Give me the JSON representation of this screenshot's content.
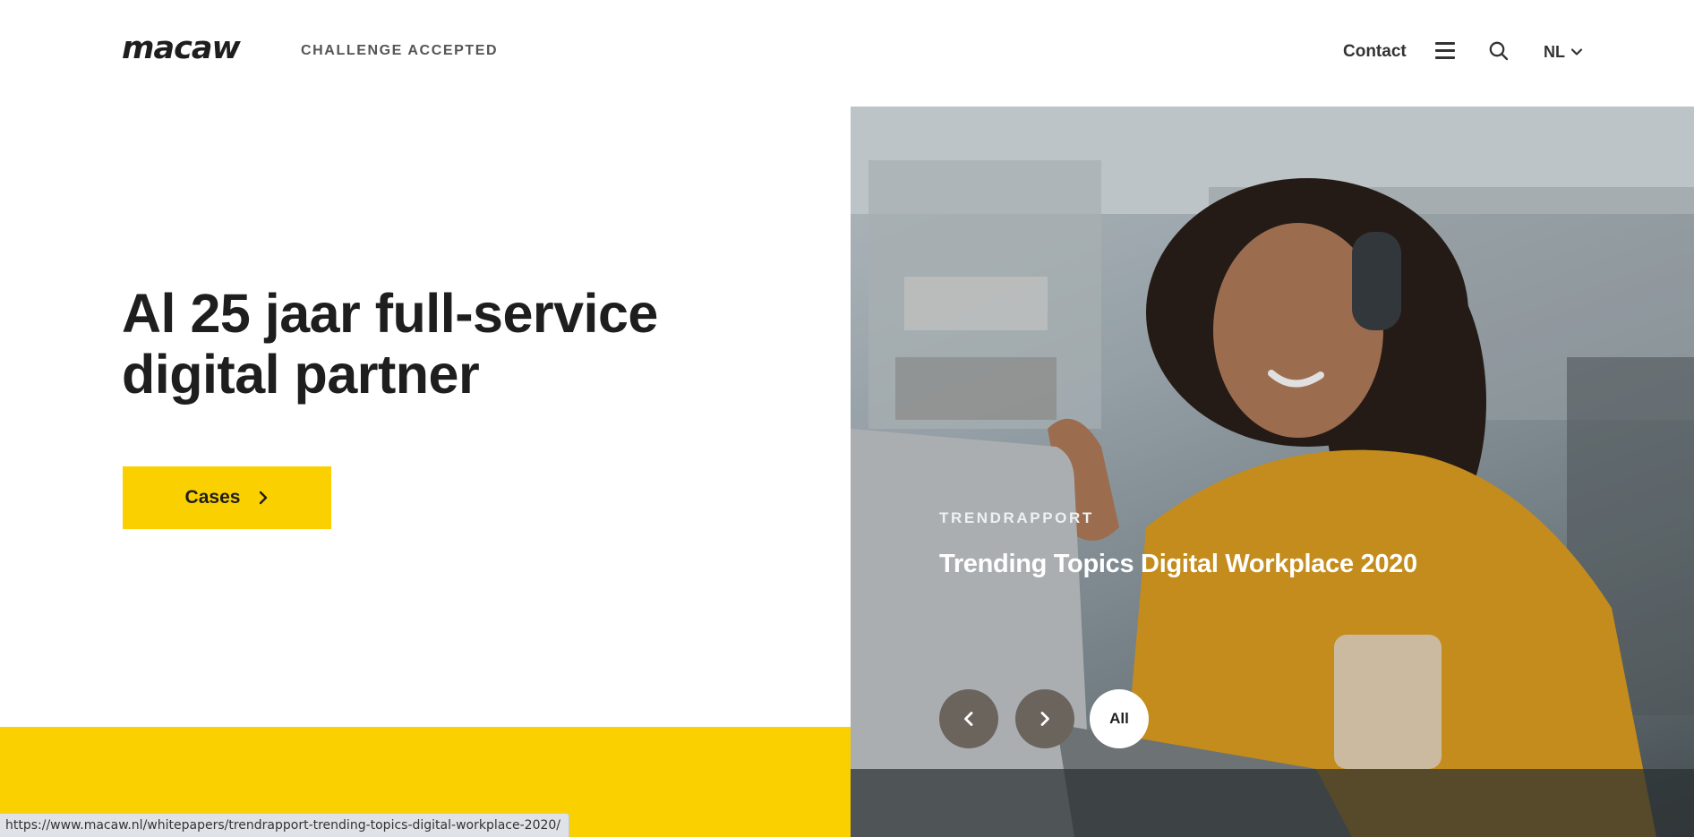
{
  "header": {
    "logo": "macaw",
    "tagline": "CHALLENGE ACCEPTED",
    "contact": "Contact",
    "language": "NL"
  },
  "hero": {
    "title_line1": "Al 25 jaar full-service",
    "title_line2": "digital partner",
    "cta_label": "Cases"
  },
  "slide": {
    "kicker": "TRENDRAPPORT",
    "title": "Trending Topics Digital Workplace 2020",
    "all_label": "All"
  },
  "statusbar": {
    "url": "https://www.macaw.nl/whitepapers/trendrapport-trending-topics-digital-workplace-2020/"
  },
  "colors": {
    "brand_yellow": "#fbd000",
    "text_dark": "#1e1e1e",
    "carousel_button": "#6b645d"
  },
  "icons": [
    "menu-icon",
    "search-icon",
    "chevron-down-icon",
    "chevron-right-icon",
    "chevron-left-icon"
  ]
}
